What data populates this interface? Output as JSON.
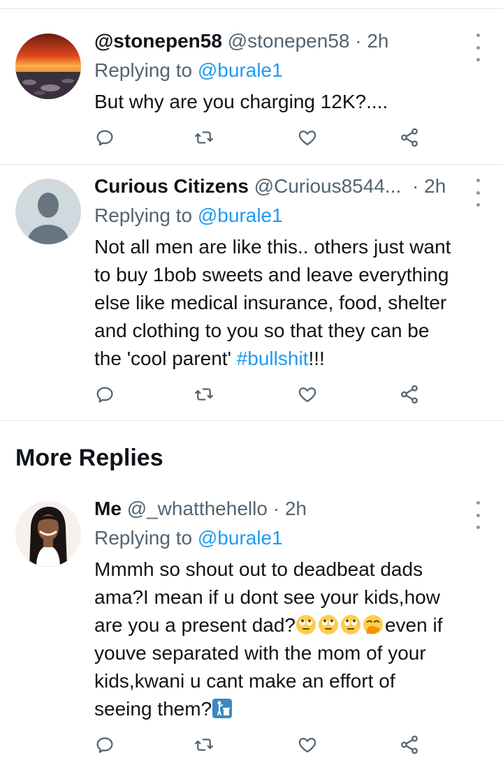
{
  "tweets": [
    {
      "name": "@stonepen58",
      "handle": "@stonepen58",
      "dot": "·",
      "time": "2h",
      "replying_prefix": "Replying to",
      "replying_to": "@burale1",
      "text": "But why are you charging 12K?...."
    },
    {
      "name": "Curious Citizens",
      "handle": "@Curious8544...",
      "dot": "·",
      "time": "2h",
      "replying_prefix": "Replying to",
      "replying_to": "@burale1",
      "text_line1": "Not all men are like this.. others just want",
      "text_line2": "to buy 1bob sweets and leave everything",
      "text_line3": "else like medical insurance, food, shelter",
      "text_line4": "and clothing to you so that they can be",
      "text_line5_pre": "the 'cool parent' ",
      "text_line5_hashtag": "#bullshit",
      "text_line5_post": "!!!"
    },
    {
      "name": "Me",
      "handle": "@_whatthehello",
      "dot": "·",
      "time": "2h",
      "replying_prefix": "Replying to",
      "replying_to": "@burale1",
      "text_line1": "Mmmh so shout out to deadbeat dads",
      "text_line2": "ama?I mean if u dont see your kids,how",
      "text_line3_pre": "are you a present dad?",
      "text_line3_post": "even if",
      "text_line4": "youve separated with the mom of your",
      "text_line5": "kids,kwani u cant make an effort of",
      "text_line6": "seeing them?",
      "emojis": [
        "face-with-rolling-eyes",
        "face-with-rolling-eyes",
        "face-with-rolling-eyes",
        "face-with-hand-over-mouth",
        "litter-in-bin-sign"
      ]
    }
  ],
  "section": {
    "more_replies": "More Replies"
  },
  "colors": {
    "link": "#1d9bf0",
    "muted": "#536471",
    "text": "#0f1419",
    "divider": "#e1e6ea"
  },
  "icons": [
    "reply-icon",
    "retweet-icon",
    "like-icon",
    "share-icon",
    "more-icon"
  ]
}
